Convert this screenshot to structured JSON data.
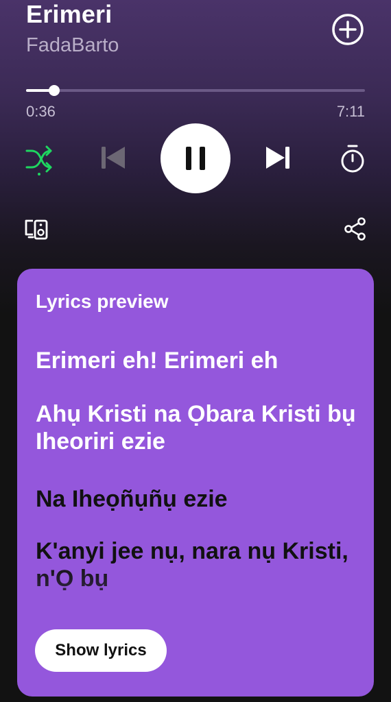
{
  "track": {
    "title": "Erimeri",
    "artist": "FadaBarto"
  },
  "playback": {
    "elapsed": "0:36",
    "total": "7:11",
    "progress_fraction": 0.084,
    "shuffle_on": true,
    "state": "playing"
  },
  "icons": {
    "add": "add-circle-icon",
    "shuffle": "shuffle-icon",
    "previous": "skip-previous-icon",
    "pause": "pause-icon",
    "next": "skip-next-icon",
    "timer": "sleep-timer-icon",
    "devices": "connect-devices-icon",
    "share": "share-icon"
  },
  "colors": {
    "accent_green": "#1ed760",
    "lyrics_card": "#9457dc"
  },
  "lyrics": {
    "heading": "Lyrics preview",
    "lines": [
      "Erimeri eh! Erimeri eh",
      "Ahụ Kristi na Ọbara Kristi bụ Iheoriri ezie",
      "Na Iheọñụñụ ezie",
      "K'anyi jee nụ, nara nụ Kristi, n'Ọ bụ"
    ],
    "button_label": "Show lyrics"
  }
}
